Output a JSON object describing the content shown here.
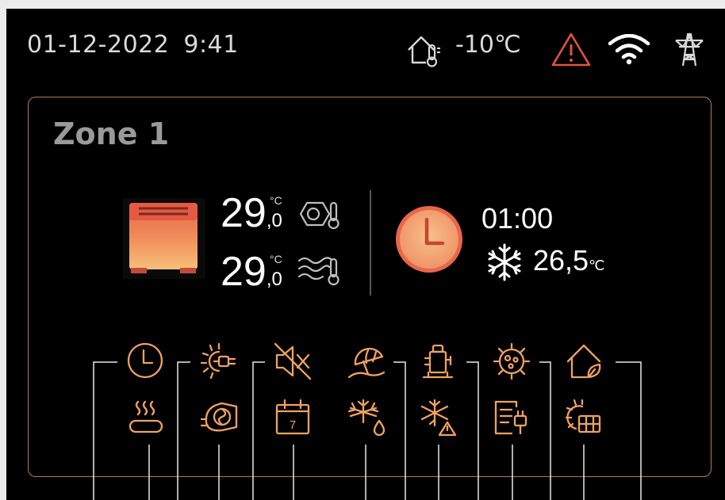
{
  "status_bar": {
    "date": "01-12-2022",
    "time": "9:41",
    "outdoor_temperature": "-10℃",
    "icons": [
      "house-thermometer-icon",
      "warning-icon",
      "wifi-icon",
      "power-tower-icon"
    ],
    "warning_color": "#e0553d"
  },
  "zone": {
    "title": "Zone 1",
    "temperature_1": {
      "integer": "29",
      "decimal": ",0",
      "unit": "°C"
    },
    "temperature_2": {
      "integer": "29",
      "decimal": ",0",
      "unit": "°C"
    },
    "schedule_time": "01:00",
    "cooling_setpoint": {
      "value": "26,5",
      "unit": "℃"
    }
  },
  "function_icons": {
    "row_1": [
      "clock-icon",
      "sun-plug-icon",
      "mute-speaker-icon",
      "beach-umbrella-icon",
      "tank-icon",
      "virus-icon",
      "eco-house-icon"
    ],
    "row_2": [
      "hot-water-icon",
      "turbine-icon",
      "calendar-icon",
      "defrost-icon",
      "freeze-warning-icon",
      "energy-meter-icon",
      "solar-grid-icon"
    ],
    "calendar_day": "7"
  },
  "colors": {
    "accent": "#f0a260",
    "border": "#b07a55",
    "background": "#000000"
  }
}
